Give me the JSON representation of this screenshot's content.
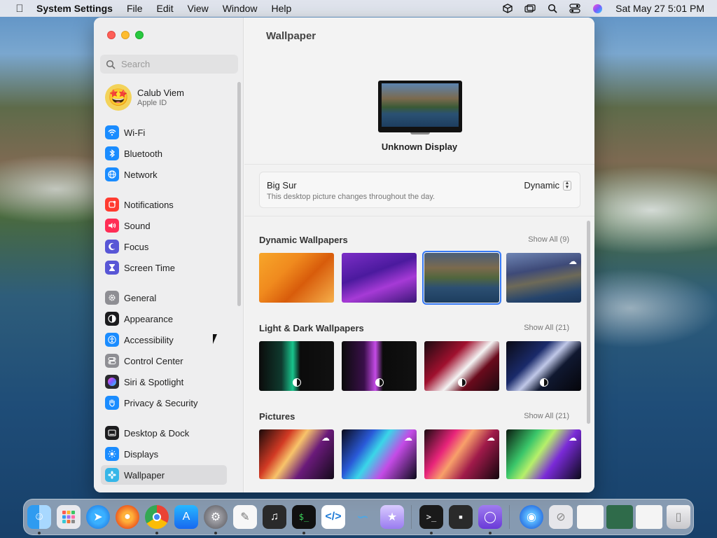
{
  "menubar": {
    "app_name": "System Settings",
    "menus": [
      "File",
      "Edit",
      "View",
      "Window",
      "Help"
    ],
    "clock": "Sat May 27  5:01 PM"
  },
  "sidebar": {
    "search_placeholder": "Search",
    "account": {
      "name": "Calub Viem",
      "subtitle": "Apple ID"
    },
    "items": [
      {
        "label": "Wi-Fi",
        "icon": "wifi-icon",
        "color": "#1a8cff"
      },
      {
        "label": "Bluetooth",
        "icon": "bluetooth-icon",
        "color": "#1a8cff"
      },
      {
        "label": "Network",
        "icon": "globe-icon",
        "color": "#1a8cff"
      },
      {
        "label": "Notifications",
        "icon": "bell-icon",
        "color": "#ff3b30"
      },
      {
        "label": "Sound",
        "icon": "speaker-icon",
        "color": "#ff2d55"
      },
      {
        "label": "Focus",
        "icon": "moon-icon",
        "color": "#5856d6"
      },
      {
        "label": "Screen Time",
        "icon": "hourglass-icon",
        "color": "#5856d6"
      },
      {
        "label": "General",
        "icon": "gear-icon",
        "color": "#8e8e93"
      },
      {
        "label": "Appearance",
        "icon": "appearance-icon",
        "color": "#1c1c1e"
      },
      {
        "label": "Accessibility",
        "icon": "accessibility-icon",
        "color": "#1a8cff"
      },
      {
        "label": "Control Center",
        "icon": "control-center-icon",
        "color": "#8e8e93"
      },
      {
        "label": "Siri & Spotlight",
        "icon": "siri-icon",
        "color": "#b03cd8"
      },
      {
        "label": "Privacy & Security",
        "icon": "hand-icon",
        "color": "#1a8cff"
      },
      {
        "label": "Desktop & Dock",
        "icon": "dock-icon",
        "color": "#1c1c1e"
      },
      {
        "label": "Displays",
        "icon": "sun-icon",
        "color": "#1a8cff"
      },
      {
        "label": "Wallpaper",
        "icon": "flower-icon",
        "color": "#35b6e8"
      }
    ],
    "selected": "Wallpaper"
  },
  "content": {
    "title": "Wallpaper",
    "display_name": "Unknown Display",
    "current": {
      "name": "Big Sur",
      "description": "This desktop picture changes throughout the day.",
      "mode": "Dynamic"
    },
    "sections": [
      {
        "title": "Dynamic Wallpapers",
        "show_all": "Show All (9)"
      },
      {
        "title": "Light & Dark Wallpapers",
        "show_all": "Show All (21)"
      },
      {
        "title": "Pictures",
        "show_all": "Show All (21)"
      }
    ]
  },
  "colors": {
    "accent": "#3478f6",
    "close": "#fe5f57",
    "minimize": "#febc2e",
    "zoom": "#28c840"
  }
}
